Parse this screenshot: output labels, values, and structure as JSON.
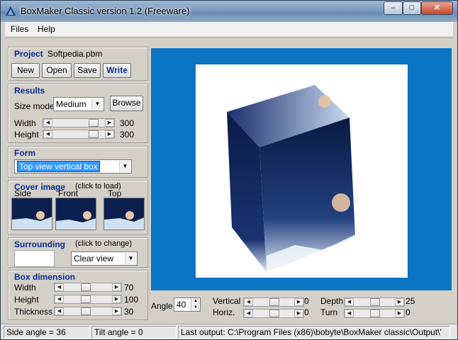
{
  "window": {
    "title": "BoxMaker Classic version 1.2 (Freeware)"
  },
  "titlebar_buttons": {
    "minimize": "–",
    "maximize": "□",
    "close": "✕"
  },
  "menu": {
    "items": [
      "Files",
      "Help"
    ]
  },
  "project": {
    "title": "Project",
    "filename": "Softpedia.pbm",
    "buttons": {
      "new": "New",
      "open": "Open",
      "save": "Save",
      "write": "Write"
    }
  },
  "results": {
    "title": "Results",
    "size_mode_label": "Size mode",
    "size_mode_value": "Medium",
    "browse": "Browse",
    "width_label": "Width",
    "width_value": "300",
    "height_label": "Height",
    "height_value": "300",
    "width_level": 0.85,
    "height_level": 0.85
  },
  "form": {
    "title": "Form",
    "selected": "Top view vertical box"
  },
  "cover": {
    "title": "Cover image",
    "hint": "(click to load)",
    "side": "Side",
    "front": "Front",
    "top": "Top"
  },
  "surrounding": {
    "title": "Surrounding",
    "hint": "(click to change)",
    "mode": "Clear view"
  },
  "dimension": {
    "title": "Box dimension",
    "width_label": "Width",
    "width_value": "70",
    "height_label": "Height",
    "height_value": "100",
    "thickness_label": "Thickness",
    "thickness_value": "30",
    "width_level": 0.45,
    "height_level": 0.45,
    "thickness_level": 0.45
  },
  "controls": {
    "angle_label": "Angle",
    "angle_value": "40",
    "vertical_label": "Vertical",
    "vertical_value": "0",
    "horiz_label": "Horiz.",
    "horiz_value": "0",
    "depth_label": "Depth",
    "depth_value": "25",
    "turn_label": "Turn",
    "turn_value": "0"
  },
  "status": {
    "side_angle": "Side angle = 36",
    "tilt_angle": "Tilt angle = 0",
    "last_output": "Last output: C:\\Program Files (x86)\\bobyte\\BoxMaker classic\\Output\\'"
  },
  "colors": {
    "accent": "#0a2a9a",
    "preview_bg": "#0b74c3",
    "selection": "#3399ff"
  }
}
